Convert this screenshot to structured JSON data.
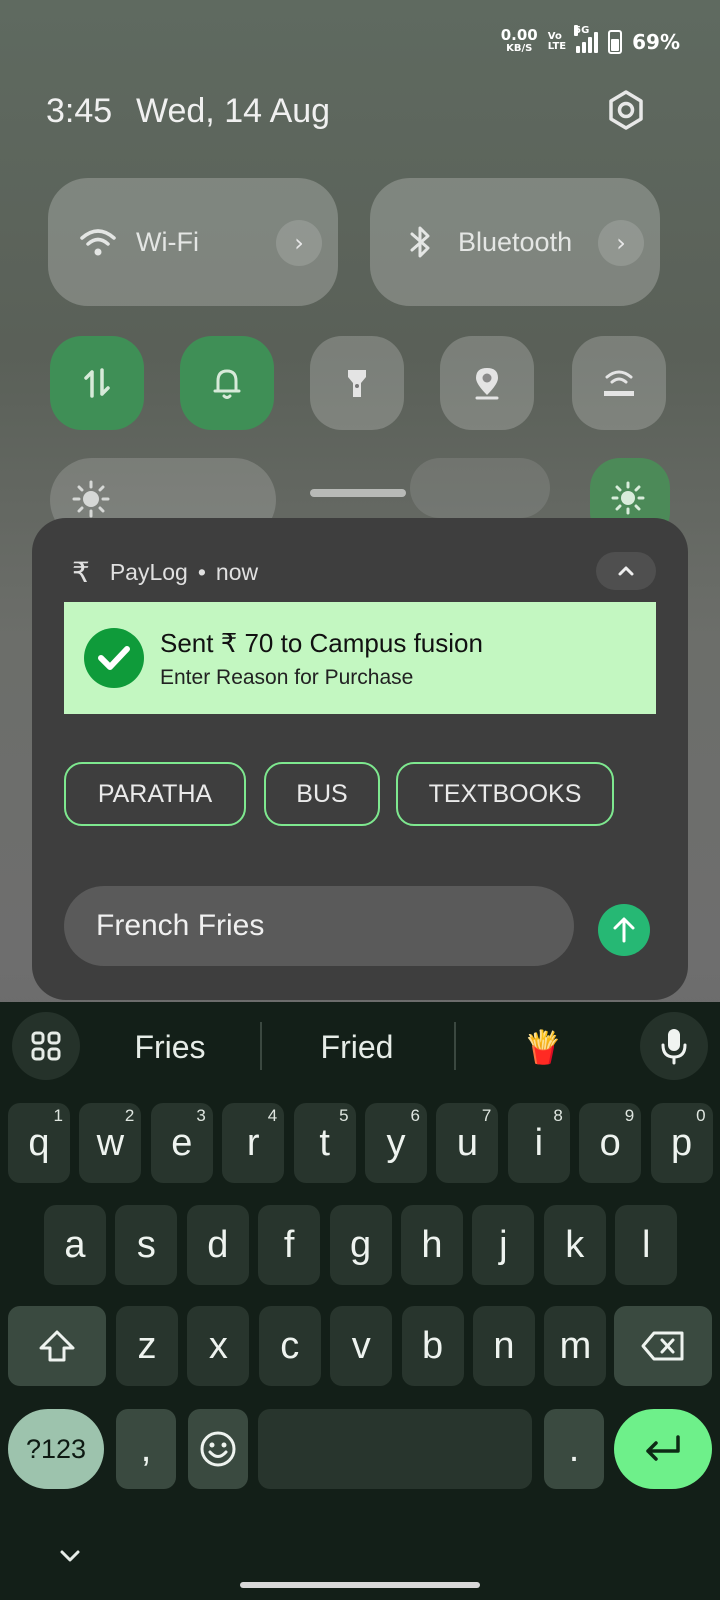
{
  "status_bar": {
    "speed_value": "0.00",
    "speed_unit": "KB/S",
    "volte_top": "Vo",
    "volte_bottom": "LTE",
    "network": "5G",
    "battery": "69%"
  },
  "header": {
    "time": "3:45",
    "date": "Wed, 14 Aug"
  },
  "tiles": {
    "wifi": {
      "label": "Wi-Fi",
      "arrow": "›"
    },
    "bluetooth": {
      "label": "Bluetooth",
      "arrow": "›"
    }
  },
  "quick_toggles": [
    {
      "icon": "mobile-data-icon",
      "state": "on"
    },
    {
      "icon": "bell-icon",
      "state": "on"
    },
    {
      "icon": "flashlight-icon",
      "state": "off"
    },
    {
      "icon": "location-icon",
      "state": "off"
    },
    {
      "icon": "hotspot-icon",
      "state": "off"
    }
  ],
  "notification": {
    "app_icon": "₹",
    "app_name": "PayLog",
    "separator": "•",
    "time": "now",
    "title": "Sent ₹ 70 to  Campus fusion",
    "subtitle": "Enter Reason for Purchase",
    "chips": [
      "PARATHA",
      "BUS",
      "TEXTBOOKS"
    ],
    "reply_text": "French Fries",
    "accent": "#c3f7c1"
  },
  "keyboard": {
    "suggestions": [
      "Fries",
      "Fried",
      "🍟"
    ],
    "row1": [
      {
        "k": "q",
        "n": "1"
      },
      {
        "k": "w",
        "n": "2"
      },
      {
        "k": "e",
        "n": "3"
      },
      {
        "k": "r",
        "n": "4"
      },
      {
        "k": "t",
        "n": "5"
      },
      {
        "k": "y",
        "n": "6"
      },
      {
        "k": "u",
        "n": "7"
      },
      {
        "k": "i",
        "n": "8"
      },
      {
        "k": "o",
        "n": "9"
      },
      {
        "k": "p",
        "n": "0"
      }
    ],
    "row2": [
      "a",
      "s",
      "d",
      "f",
      "g",
      "h",
      "j",
      "k",
      "l"
    ],
    "row3": [
      "z",
      "x",
      "c",
      "v",
      "b",
      "n",
      "m"
    ],
    "num_key": "?123",
    "comma": ",",
    "period": "."
  }
}
